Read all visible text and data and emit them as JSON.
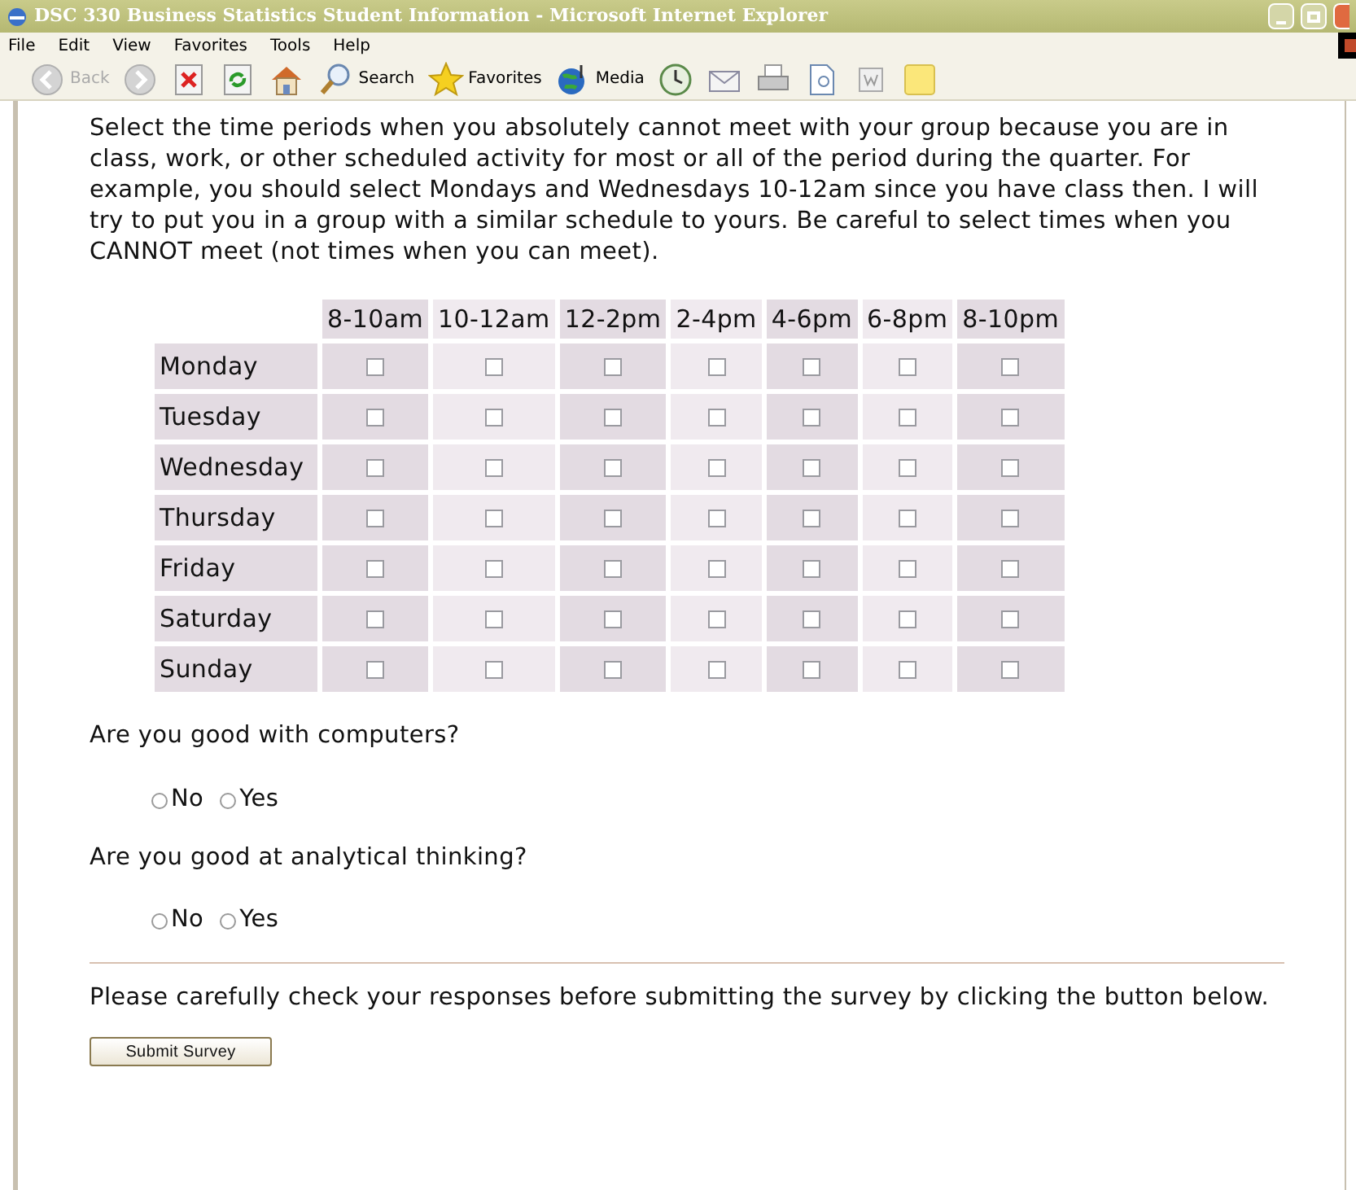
{
  "window": {
    "title": "DSC 330 Business Statistics Student Information - Microsoft Internet Explorer"
  },
  "menu": [
    "File",
    "Edit",
    "View",
    "Favorites",
    "Tools",
    "Help"
  ],
  "toolbar": [
    {
      "kind": "back",
      "label": "Back"
    },
    {
      "kind": "forward"
    },
    {
      "kind": "stop"
    },
    {
      "kind": "refresh"
    },
    {
      "kind": "home"
    },
    {
      "kind": "search",
      "label": "Search"
    },
    {
      "kind": "favorites",
      "label": "Favorites"
    },
    {
      "kind": "media",
      "label": "Media"
    },
    {
      "kind": "history"
    },
    {
      "kind": "mail"
    },
    {
      "kind": "print"
    },
    {
      "kind": "edit"
    },
    {
      "kind": "word"
    },
    {
      "kind": "note"
    }
  ],
  "instructions": "Select the time periods when you absolutely cannot meet with your group because you are in class, work, or other scheduled activity for most or all of the period during the quarter. For example, you should select Mondays and Wednesdays 10-12am since you have class then. I will try to put you in a group with a similar schedule to yours. Be careful to select times when you CANNOT meet (not times when you can meet).",
  "schedule": {
    "columns": [
      "8-10am",
      "10-12am",
      "12-2pm",
      "2-4pm",
      "4-6pm",
      "6-8pm",
      "8-10pm"
    ],
    "rows": [
      {
        "day": "Monday",
        "slots": [
          {
            "checked": false
          },
          {
            "checked": false
          },
          {
            "checked": false
          },
          {
            "checked": false
          },
          {
            "checked": false
          },
          {
            "checked": false
          },
          {
            "checked": false
          }
        ]
      },
      {
        "day": "Tuesday",
        "slots": [
          {
            "checked": false
          },
          {
            "checked": false
          },
          {
            "checked": false
          },
          {
            "checked": false
          },
          {
            "checked": false
          },
          {
            "checked": false
          },
          {
            "checked": false
          }
        ]
      },
      {
        "day": "Wednesday",
        "slots": [
          {
            "checked": false
          },
          {
            "checked": false
          },
          {
            "checked": false
          },
          {
            "checked": false
          },
          {
            "checked": false
          },
          {
            "checked": false
          },
          {
            "checked": false
          }
        ]
      },
      {
        "day": "Thursday",
        "slots": [
          {
            "checked": false
          },
          {
            "checked": false
          },
          {
            "checked": false
          },
          {
            "checked": false
          },
          {
            "checked": false
          },
          {
            "checked": false
          },
          {
            "checked": false
          }
        ]
      },
      {
        "day": "Friday",
        "slots": [
          {
            "checked": false
          },
          {
            "checked": false
          },
          {
            "checked": false
          },
          {
            "checked": false
          },
          {
            "checked": false
          },
          {
            "checked": false
          },
          {
            "checked": false
          }
        ]
      },
      {
        "day": "Saturday",
        "slots": [
          {
            "checked": false
          },
          {
            "checked": false
          },
          {
            "checked": false
          },
          {
            "checked": false
          },
          {
            "checked": false
          },
          {
            "checked": false
          },
          {
            "checked": false
          }
        ]
      },
      {
        "day": "Sunday",
        "slots": [
          {
            "checked": false
          },
          {
            "checked": false
          },
          {
            "checked": false
          },
          {
            "checked": false
          },
          {
            "checked": false
          },
          {
            "checked": false
          },
          {
            "checked": false
          }
        ]
      }
    ]
  },
  "questions": [
    {
      "text": "Are you good with computers?",
      "options": [
        {
          "label": "No",
          "selected": false
        },
        {
          "label": "Yes",
          "selected": false
        }
      ]
    },
    {
      "text": "Are you good at analytical thinking?",
      "options": [
        {
          "label": "No",
          "selected": false
        },
        {
          "label": "Yes",
          "selected": false
        }
      ]
    }
  ],
  "note": "Please carefully check your responses before submitting the survey by clicking the button below.",
  "submit": "Submit Survey"
}
